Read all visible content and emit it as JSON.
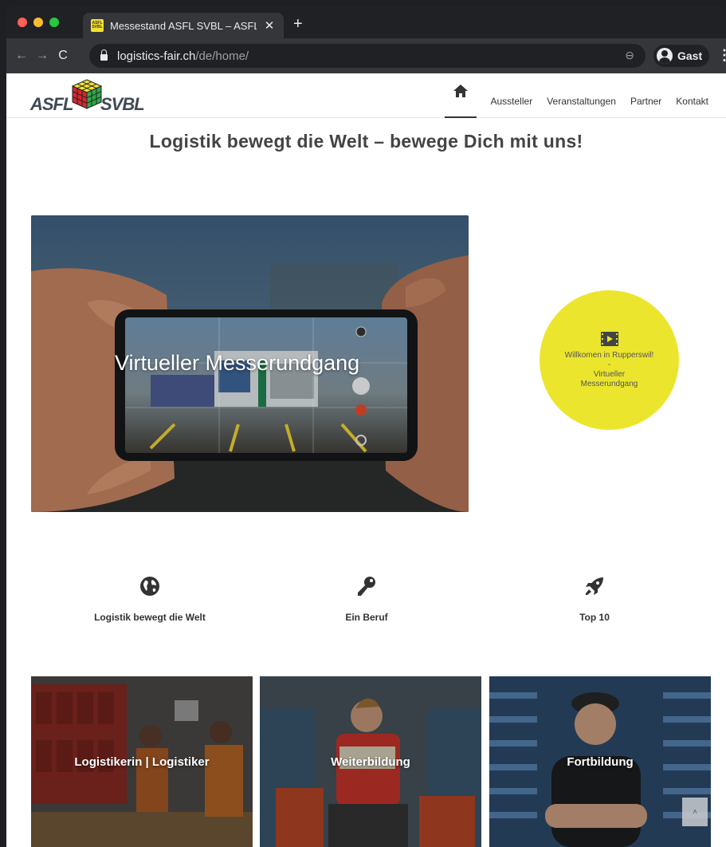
{
  "browser": {
    "tab_title": "Messestand ASFL SVBL – ASFL",
    "favicon_text": "ASFL SVBL",
    "new_tab_label": "+",
    "url_host": "logistics-fair.ch",
    "url_path": "/de/home/",
    "profile_name": "Gast"
  },
  "site": {
    "logo_left": "ASFL",
    "logo_right": "SVBL",
    "nav": {
      "items": [
        "Aussteller",
        "Veranstaltungen",
        "Partner",
        "Kontakt"
      ]
    },
    "headline": "Logistik bewegt die Welt – bewege Dich mit uns!",
    "hero": {
      "title": "Virtueller Messerundgang"
    },
    "promo": {
      "line1": "Willkomen in Rupperswil!",
      "separator": "-",
      "line2": "Virtueller",
      "line3": "Messerundgang"
    },
    "features": [
      {
        "label": "Logistik bewegt die Welt",
        "icon": "globe-icon"
      },
      {
        "label": "Ein Beruf",
        "icon": "key-icon"
      },
      {
        "label": "Top 10",
        "icon": "rocket-icon"
      }
    ],
    "tiles": [
      {
        "label": "Logistikerin | Logistiker"
      },
      {
        "label": "Weiterbildung"
      },
      {
        "label": "Fortbildung"
      }
    ],
    "scroll_top_label": "˄"
  },
  "colors": {
    "accent_yellow": "#ece52e",
    "logo_text": "#3f4a55",
    "chrome_bg": "#202124"
  }
}
